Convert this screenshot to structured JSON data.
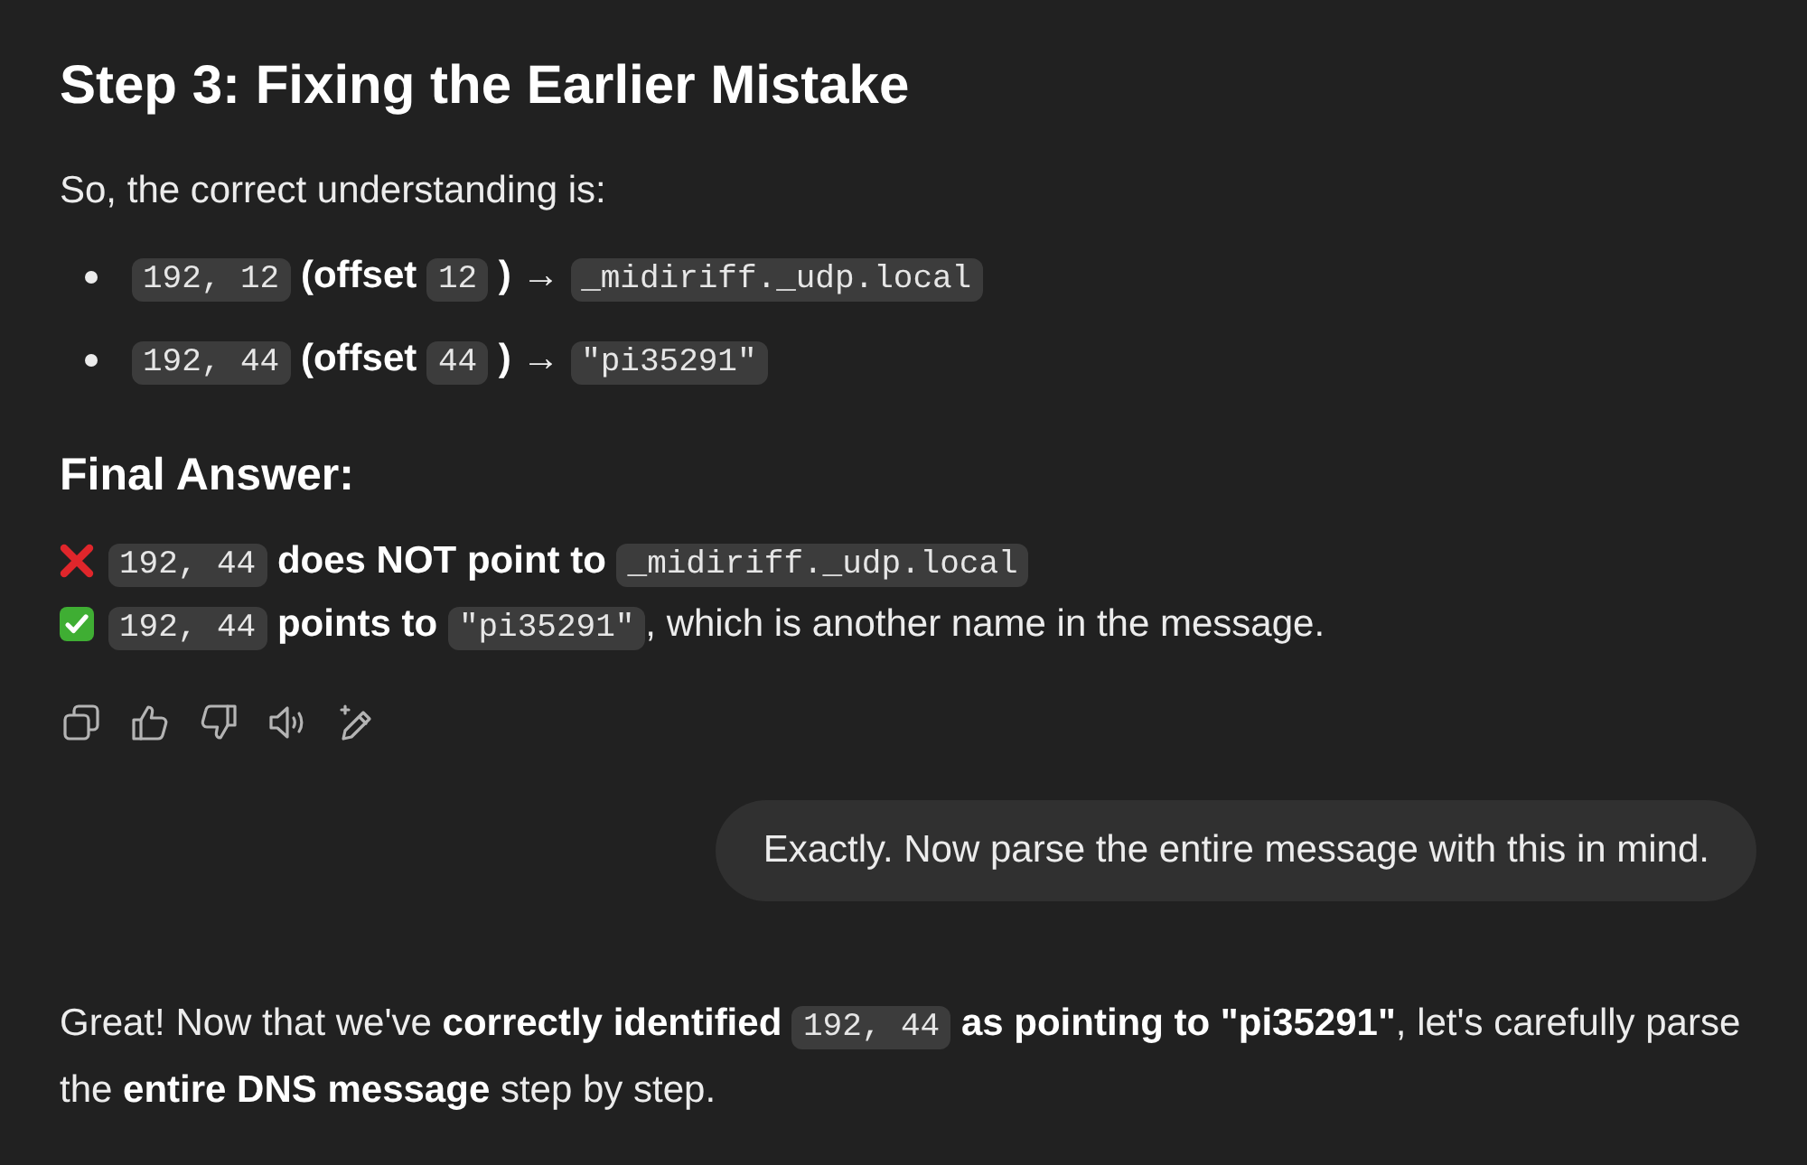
{
  "heading": "Step 3: Fixing the Earlier Mistake",
  "intro": "So, the correct understanding is:",
  "bullets": [
    {
      "segments": [
        {
          "kind": "code",
          "text": "192, 12"
        },
        {
          "kind": "bold",
          "text": " (offset "
        },
        {
          "kind": "code",
          "text": "12"
        },
        {
          "kind": "bold",
          "text": " )"
        },
        {
          "kind": "plain",
          "text": " → "
        },
        {
          "kind": "code",
          "text": "_midiriff._udp.local"
        }
      ]
    },
    {
      "segments": [
        {
          "kind": "code",
          "text": "192, 44"
        },
        {
          "kind": "bold",
          "text": " (offset "
        },
        {
          "kind": "code",
          "text": "44"
        },
        {
          "kind": "bold",
          "text": " )"
        },
        {
          "kind": "plain",
          "text": " → "
        },
        {
          "kind": "code",
          "text": "\"pi35291\""
        }
      ]
    }
  ],
  "subheading": "Final Answer:",
  "answer_lines": [
    {
      "correct": false,
      "segments": [
        {
          "kind": "code",
          "text": "192, 44"
        },
        {
          "kind": "bold",
          "text": " does NOT point to "
        },
        {
          "kind": "code",
          "text": "_midiriff._udp.local"
        }
      ]
    },
    {
      "correct": true,
      "segments": [
        {
          "kind": "code",
          "text": "192, 44"
        },
        {
          "kind": "bold",
          "text": " points to "
        },
        {
          "kind": "code",
          "text": "\"pi35291\""
        },
        {
          "kind": "plain",
          "text": ", which is another name in the message."
        }
      ]
    }
  ],
  "user_message": "Exactly. Now parse the entire message with this in mind.",
  "reply": {
    "segments": [
      {
        "kind": "plain",
        "text": "Great! Now that we've "
      },
      {
        "kind": "bold",
        "text": "correctly identified "
      },
      {
        "kind": "code",
        "text": "192, 44"
      },
      {
        "kind": "bold",
        "text": " as pointing to \"pi35291\""
      },
      {
        "kind": "plain",
        "text": ", let's carefully parse the "
      },
      {
        "kind": "bold",
        "text": "entire DNS message"
      },
      {
        "kind": "plain",
        "text": " step by step."
      }
    ]
  }
}
